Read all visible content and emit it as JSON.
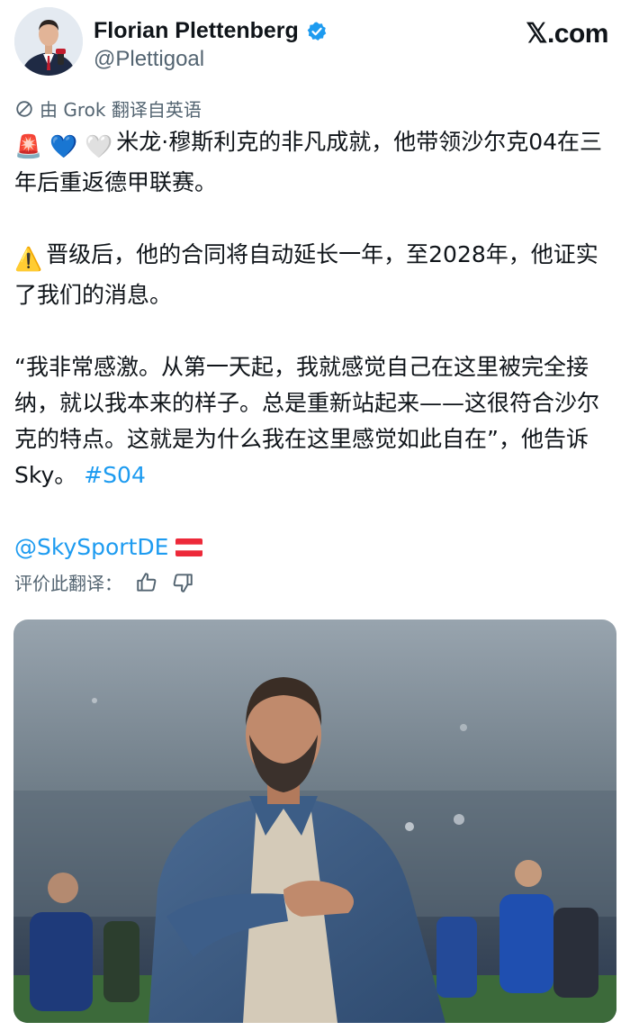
{
  "author": {
    "name": "Florian Plettenberg",
    "handle": "@Plettigoal",
    "verified_icon": "verified-badge-icon",
    "avatar_icon": "avatar-photo"
  },
  "brand": {
    "label": "𝕏.com"
  },
  "translation": {
    "notice": "由 Grok 翻译自英语",
    "icon": "translate-icon",
    "rate_label": "评价此翻译：",
    "thumbs_up_icon": "thumbs-up-icon",
    "thumbs_down_icon": "thumbs-down-icon"
  },
  "tweet": {
    "line1_emojis": "🚨 💙 🤍",
    "line1_text": "米龙·穆斯利克的非凡成就，他带领沙尔克04在三年后重返德甲联赛。",
    "line2_emoji": "⚠️",
    "line2_text": "晋级后，他的合同将自动延长一年，至2028年，他证实了我们的消息。",
    "quote_text": "“我非常感激。从第一天起，我就感觉自己在这里被完全接纳，就以我本来的样子。总是重新站起来——这很符合沙尔克的特点。这就是为什么我在这里感觉如此自在”，他告诉Sky。",
    "hashtag": "#S04",
    "mention": "@SkySportDE",
    "flag_icon": "austria-flag-icon"
  },
  "media": {
    "icon": "tweet-photo"
  },
  "colors": {
    "text": "#0f1419",
    "secondary": "#536471",
    "link": "#1d9bf0",
    "verified": "#1d9bf0"
  }
}
